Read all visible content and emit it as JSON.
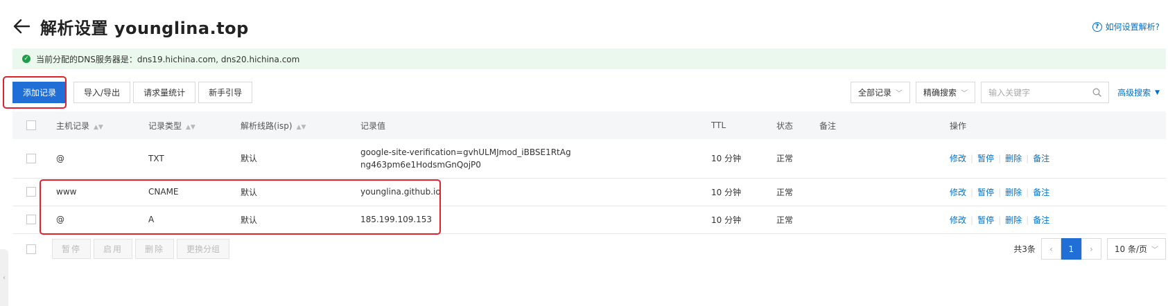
{
  "header": {
    "title": "解析设置 younglina.top",
    "help_label": "如何设置解析?"
  },
  "notice": {
    "text": "当前分配的DNS服务器是：dns19.hichina.com, dns20.hichina.com"
  },
  "toolbar": {
    "add_record": "添加记录",
    "import_export": "导入/导出",
    "request_stats": "请求量统计",
    "beginner_guide": "新手引导"
  },
  "filters": {
    "record_select": "全部记录",
    "search_mode": "精确搜索",
    "search_placeholder": "输入关键字",
    "advanced_search": "高级搜索"
  },
  "table": {
    "headers": {
      "host": "主机记录",
      "type": "记录类型",
      "line": "解析线路(isp)",
      "value": "记录值",
      "ttl": "TTL",
      "status": "状态",
      "remark": "备注",
      "ops": "操作"
    },
    "rows": [
      {
        "host": "@",
        "type": "TXT",
        "line": "默认",
        "value_line1": "google-site-verification=gvhULMJmod_iBBSE1RtAg",
        "value_line2": "ng463pm6e1HodsmGnQojP0",
        "ttl": "10 分钟",
        "status": "正常",
        "remark": ""
      },
      {
        "host": "www",
        "type": "CNAME",
        "line": "默认",
        "value_line1": "younglina.github.io",
        "value_line2": "",
        "ttl": "10 分钟",
        "status": "正常",
        "remark": ""
      },
      {
        "host": "@",
        "type": "A",
        "line": "默认",
        "value_line1": "185.199.109.153",
        "value_line2": "",
        "ttl": "10 分钟",
        "status": "正常",
        "remark": ""
      }
    ],
    "ops": {
      "edit": "修改",
      "pause": "暂停",
      "delete": "删除",
      "remark": "备注"
    }
  },
  "footer": {
    "pause": "暂停",
    "enable": "启用",
    "delete": "删除",
    "change_group": "更换分组",
    "total": "共3条",
    "current_page": "1",
    "page_size": "10 条/页"
  },
  "colors": {
    "primary": "#1f6fd6",
    "link": "#0070cc",
    "success": "#1e9e4a",
    "highlight": "#e2202a",
    "notice_bg": "#ebf8ed"
  }
}
